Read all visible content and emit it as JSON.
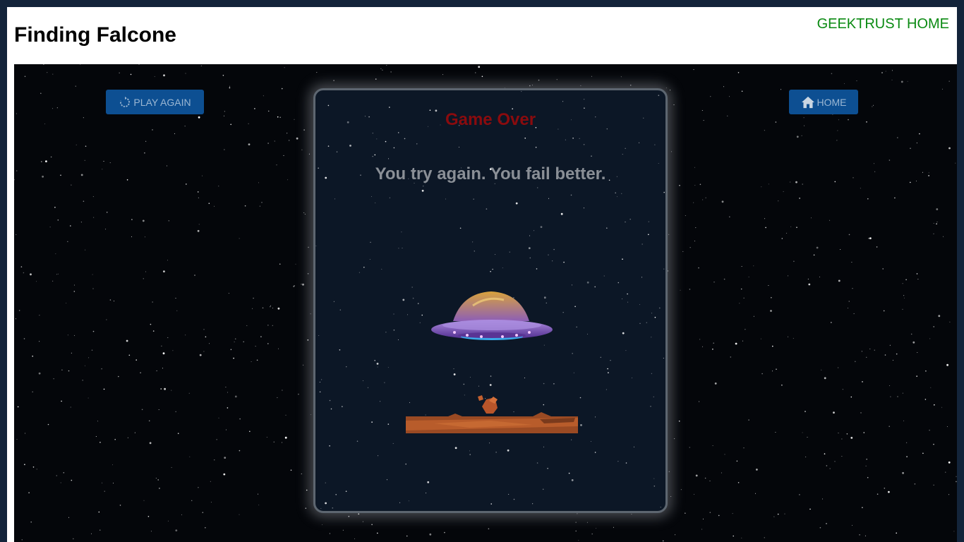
{
  "header": {
    "title": "Finding Falcone",
    "home_link": "GEEKTRUST HOME"
  },
  "buttons": {
    "play_again": {
      "label": "PLAY AGAIN",
      "icon": "refresh-icon"
    },
    "home": {
      "label": "HOME",
      "icon": "home-icon"
    }
  },
  "result": {
    "title": "Game Over",
    "message": "You try again. You fail better."
  },
  "colors": {
    "header_link": "#0a8a12",
    "button_bg": "#0d4f92",
    "title_red": "#8a0b0e",
    "space_bg": "#04060a"
  }
}
